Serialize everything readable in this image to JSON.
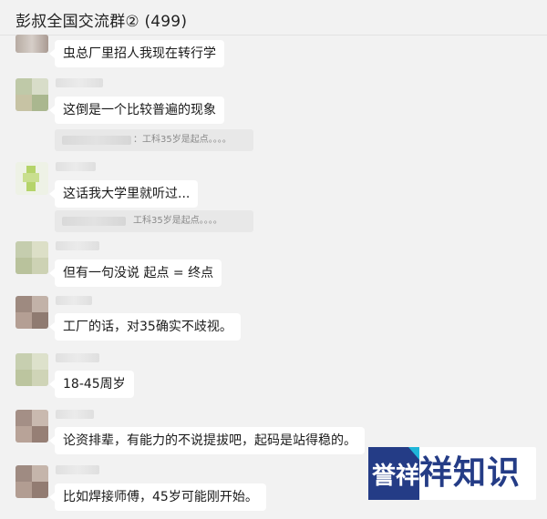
{
  "header": {
    "title": "彭叔全国交流群② (499)"
  },
  "messages": [
    {
      "text": "虫总厂里招人我现在转行学"
    },
    {
      "text": "这倒是一个比较普遍的现象"
    },
    {
      "quote": "：工科35岁是起点。。。。"
    },
    {
      "text": "这话我大学里就听过..."
    },
    {
      "quote": "工科35岁是起点。。。。"
    },
    {
      "text": "但有一句没说 起点 = 终点"
    },
    {
      "text": "工厂的话，对35确实不歧视。"
    },
    {
      "text": "18-45周岁"
    },
    {
      "text": "论资排辈，有能力的不说提拔吧，起码是站得稳的。"
    },
    {
      "text": "比如焊接师傅，45岁可能刚开始。"
    }
  ],
  "watermark": {
    "mark": "誉祥",
    "text": "祥知识"
  }
}
